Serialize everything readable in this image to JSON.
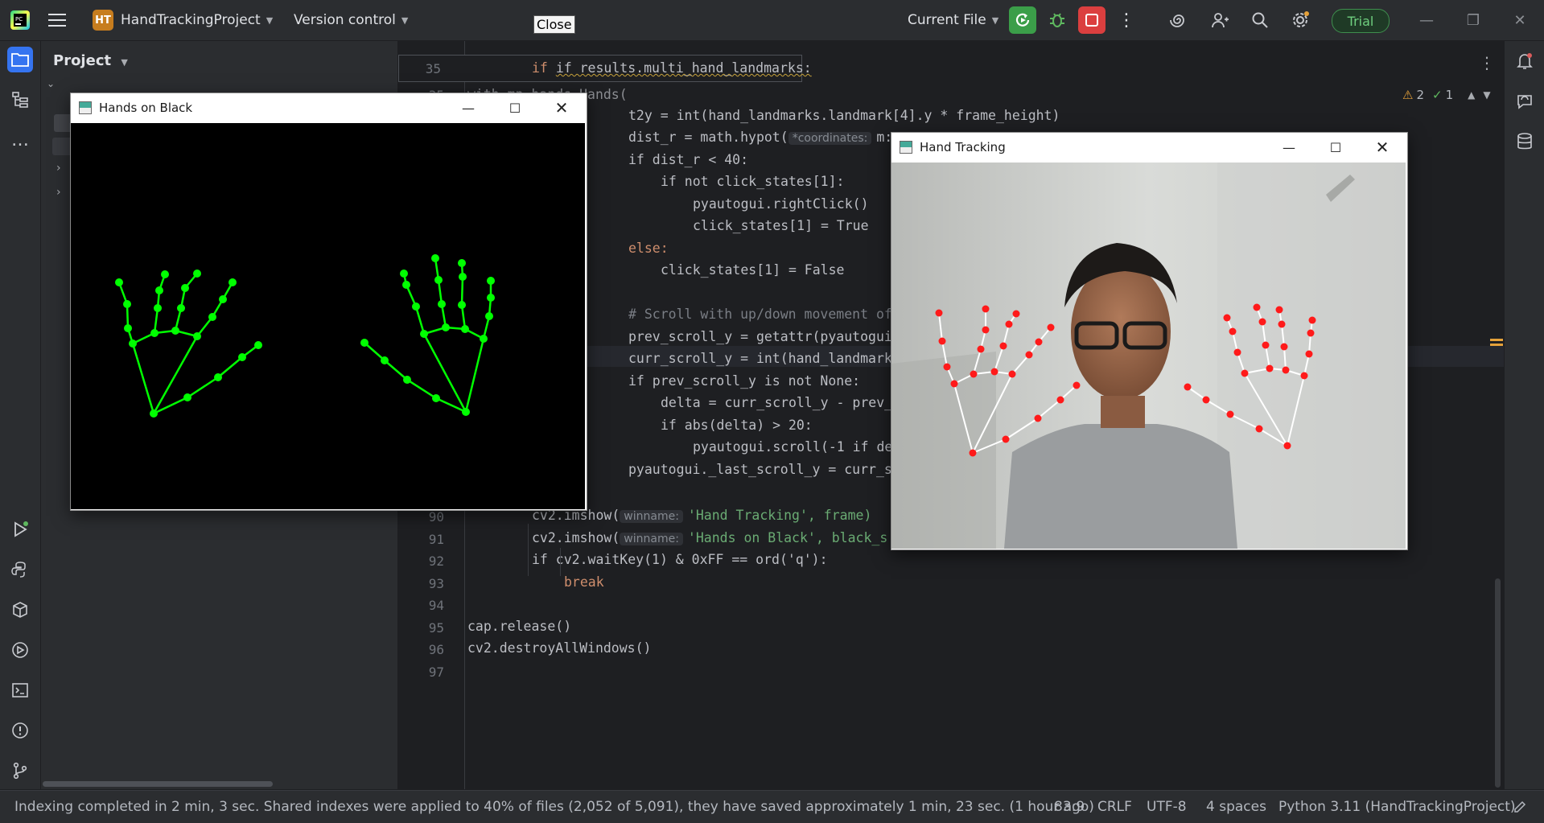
{
  "titlebar": {
    "project_badge": "HT",
    "project_name": "HandTrackingProject",
    "vcs": "Version control",
    "run_config": "Current File",
    "trial": "Trial"
  },
  "tooltip": {
    "close": "Close"
  },
  "project_panel": {
    "title": "Project"
  },
  "editor": {
    "sticky_line_number": "35",
    "sticky_code": "if results.multi_hand_landmarks:",
    "partial_line": "with mp_hands.Hands(",
    "inspections": {
      "warnings": "2",
      "ok": "1"
    },
    "hints": {
      "coordinates": "*coordinates:",
      "winname": "winname:"
    },
    "lines": [
      {
        "n": "90",
        "code": "cv2.imshow("
      },
      {
        "n": "91",
        "code": "cv2.imshow("
      },
      {
        "n": "92",
        "code": "if cv2.waitKey(1) & 0xFF == ord('q'):"
      },
      {
        "n": "93",
        "code": "break"
      },
      {
        "n": "94",
        "code": ""
      },
      {
        "n": "95",
        "code": "cap.release()"
      },
      {
        "n": "96",
        "code": "cv2.destroyAllWindows()"
      },
      {
        "n": "97",
        "code": ""
      }
    ],
    "visible_code": {
      "l1": "t2y = int(hand_landmarks.landmark[4].y * frame_height)",
      "l2a": "dist_r = math.hypot(",
      "l2b": "m:",
      "l3": "if dist_r < 40:",
      "l4": "if not click_states[1]:",
      "l5": "pyautogui.rightClick()",
      "l6": "click_states[1] = True",
      "l7": "else:",
      "l8": "click_states[1] = False",
      "l9": "# Scroll with up/down movement of",
      "l10": "prev_scroll_y = getattr(pyautogui",
      "l11": "curr_scroll_y = int(hand_landmark",
      "l12": "if prev_scroll_y is not None:",
      "l13": "delta = curr_scroll_y - prev_",
      "l14": "if abs(delta) > 20:",
      "l15": "pyautogui.scroll(-1 if de",
      "l16": "pyautogui._last_scroll_y = curr_s",
      "l90": "'Hand Tracking', frame)",
      "l91": "'Hands on Black', black_s"
    }
  },
  "windows": {
    "black": {
      "title": "Hands on Black"
    },
    "tracking": {
      "title": "Hand Tracking"
    }
  },
  "statusbar": {
    "message": "Indexing completed in 2 min, 3 sec. Shared indexes were applied to 40% of files (2,052 of 5,091), they have saved approximately 1 min, 23 sec. (1 hour ago)",
    "position": "83:9",
    "line_sep": "CRLF",
    "encoding": "UTF-8",
    "indent": "4 spaces",
    "interpreter": "Python 3.11 (HandTrackingProject)"
  },
  "colors": {
    "accent_green": "#3b9e49",
    "stop_red": "#db3f3f",
    "landmark_green": "#00ff00",
    "landmark_red": "#ff1a1a"
  }
}
